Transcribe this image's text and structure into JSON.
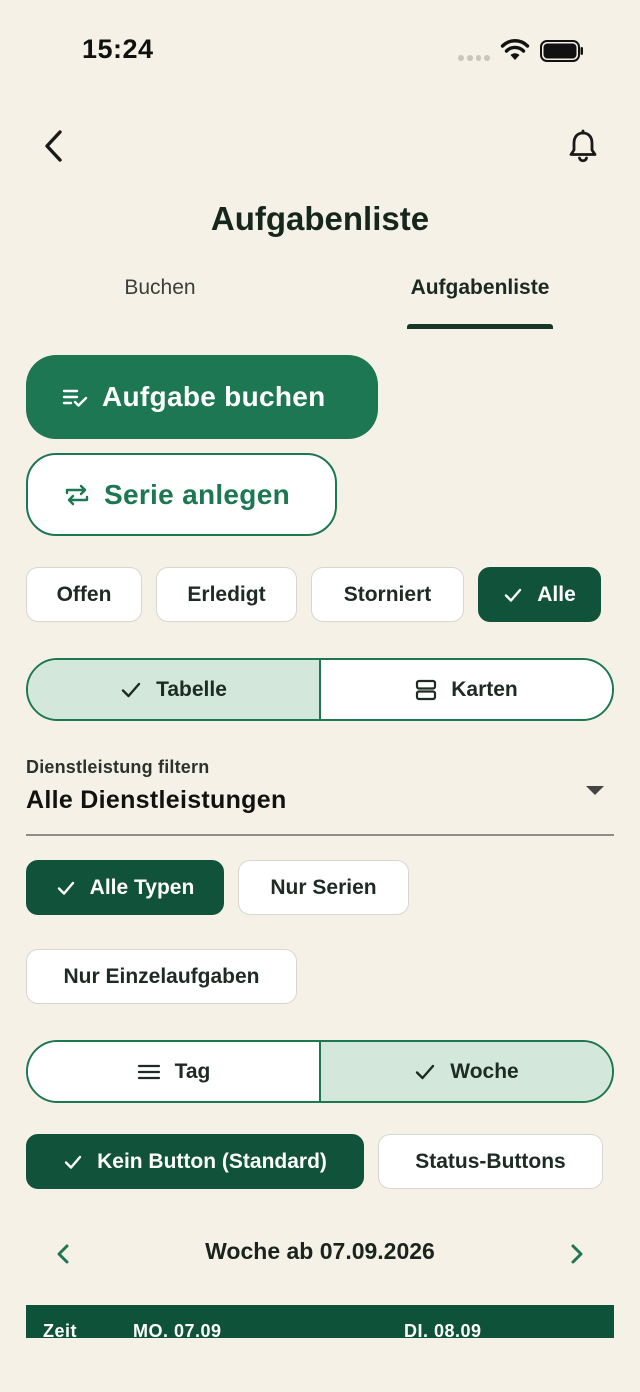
{
  "status_bar": {
    "time": "15:24"
  },
  "header": {
    "title": "Aufgabenliste"
  },
  "tabs": [
    {
      "label": "Buchen"
    },
    {
      "label": "Aufgabenliste"
    }
  ],
  "actions": {
    "book_task": "Aufgabe buchen",
    "create_series": "Serie anlegen"
  },
  "status_filter": {
    "options": [
      "Offen",
      "Erledigt",
      "Storniert",
      "Alle"
    ],
    "selected": "Alle"
  },
  "view_toggle": {
    "options": [
      "Tabelle",
      "Karten"
    ],
    "selected": "Tabelle"
  },
  "service_filter": {
    "label": "Dienstleistung filtern",
    "value": "Alle Dienstleistungen"
  },
  "type_filter": {
    "options": [
      "Alle Typen",
      "Nur Serien",
      "Nur Einzelaufgaben"
    ],
    "selected": "Alle Typen"
  },
  "period_toggle": {
    "options": [
      "Tag",
      "Woche"
    ],
    "selected": "Woche"
  },
  "button_mode": {
    "options": [
      "Kein Button (Standard)",
      "Status-Buttons"
    ],
    "selected": "Kein Button (Standard)"
  },
  "week_nav": {
    "title": "Woche ab 07.09.2026"
  },
  "table": {
    "columns": [
      "Zeit",
      "MO. 07.09",
      "DI. 08.09"
    ]
  },
  "colors": {
    "background": "#f5f1e6",
    "primary": "#1c7752",
    "primary_dark": "#10523a",
    "selected_segment": "#d3e7da"
  }
}
